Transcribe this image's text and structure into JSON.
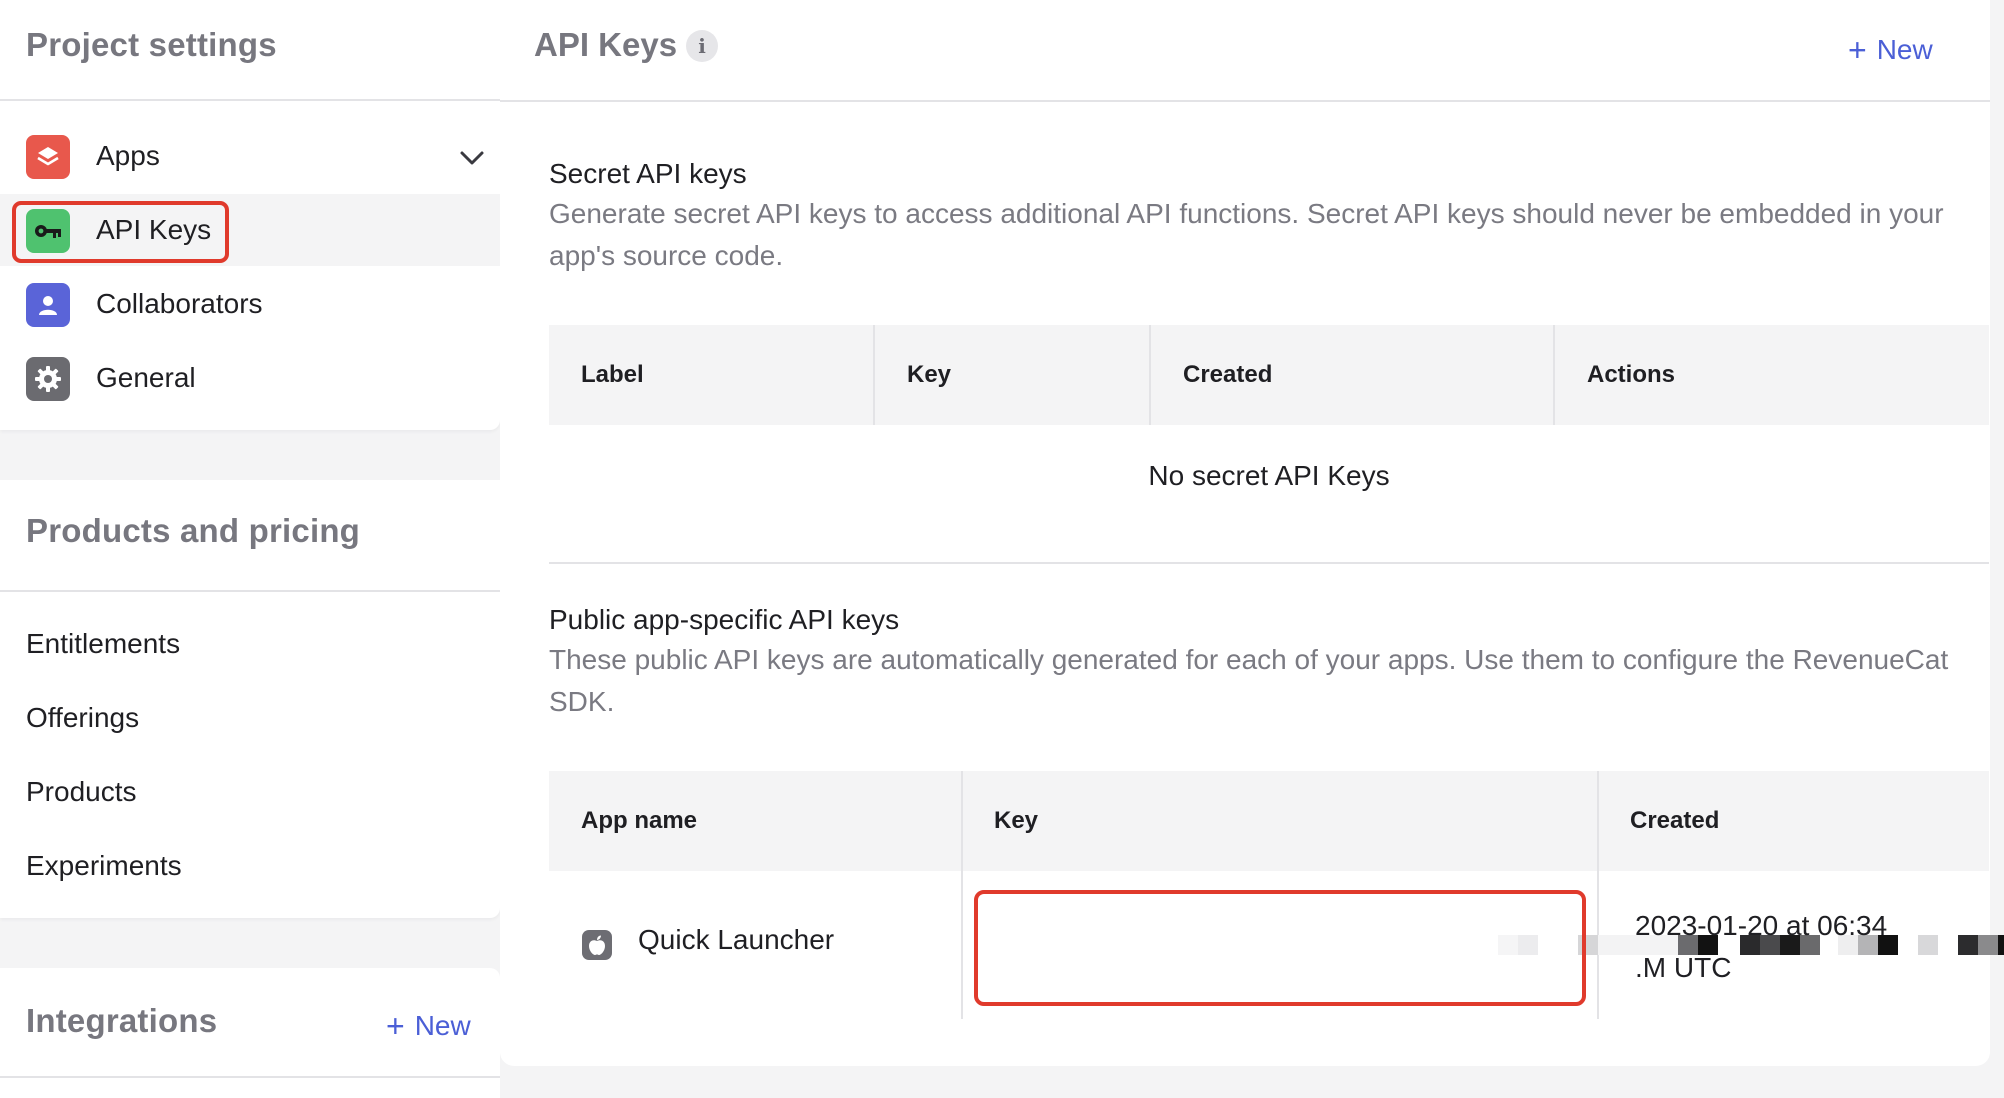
{
  "sidebar": {
    "project_settings": {
      "title": "Project settings",
      "items": [
        {
          "label": "Apps",
          "icon": "stack-icon",
          "color": "#e8584c"
        },
        {
          "label": "API Keys",
          "icon": "key-icon",
          "color": "#4fc26f",
          "active": true,
          "highlighted": true
        },
        {
          "label": "Collaborators",
          "icon": "person-icon",
          "color": "#5a64d8"
        },
        {
          "label": "General",
          "icon": "gear-icon",
          "color": "#6b6b70"
        }
      ]
    },
    "products_and_pricing": {
      "title": "Products and pricing",
      "items": [
        "Entitlements",
        "Offerings",
        "Products",
        "Experiments"
      ]
    },
    "integrations": {
      "title": "Integrations",
      "new_label": "New"
    }
  },
  "main": {
    "title": "API Keys",
    "new_label": "New",
    "secret": {
      "title": "Secret API keys",
      "description": "Generate secret API keys to access additional API functions. Secret API keys should never be embedded in your app's source code.",
      "columns": [
        "Label",
        "Key",
        "Created",
        "Actions"
      ],
      "empty_message": "No secret API Keys"
    },
    "public": {
      "title": "Public app-specific API keys",
      "description": "These public API keys are automatically generated for each of your apps. Use them to configure the RevenueCat SDK.",
      "columns": [
        "App name",
        "Key",
        "Created"
      ],
      "rows": [
        {
          "app_name": "Quick Launcher",
          "app_icon": "apple-icon",
          "key": "",
          "created_line1": "2023-01-20 at 06:34",
          "created_line2": ".M UTC"
        }
      ]
    }
  },
  "colors": {
    "accent": "#4b5fd6",
    "highlight": "#e03a2c"
  }
}
